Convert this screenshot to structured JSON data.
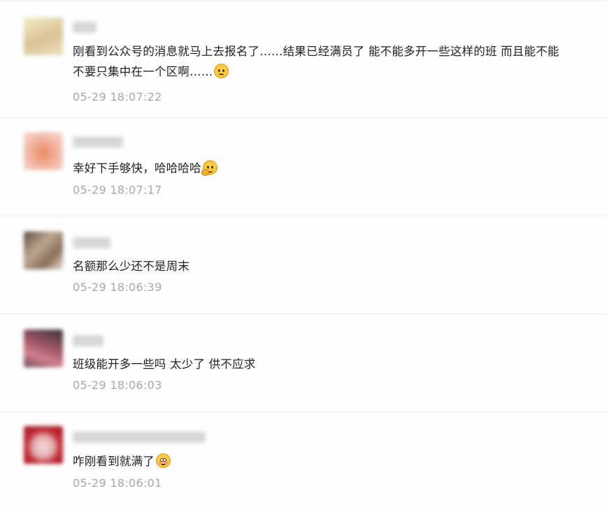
{
  "comments": [
    {
      "avatar_color": [
        "#efe3b8",
        "#d9c49a"
      ],
      "name_width": 34,
      "text": "刚看到公众号的消息就马上去报名了……结果已经满员了 能不能多开一些这样的班 而且能不能不要只集中在一个区啊……",
      "emoji": "sad-face-icon",
      "time": "05-29 18:07:22"
    },
    {
      "avatar_color": [
        "#f5c0b0",
        "#e79a80"
      ],
      "name_width": 72,
      "text": "幸好下手够快，哈哈哈哈",
      "emoji": "thinking-face-icon",
      "time": "05-29 18:07:17"
    },
    {
      "avatar_color": [
        "#b9a590",
        "#6b5a50"
      ],
      "name_width": 54,
      "text": "名额那么少还不是周末",
      "emoji": "",
      "time": "05-29 18:06:39"
    },
    {
      "avatar_color": [
        "#b56a78",
        "#4a3a3e"
      ],
      "name_width": 44,
      "text": "班级能开多一些吗 太少了 供不应求",
      "emoji": "",
      "time": "05-29 18:06:03"
    },
    {
      "avatar_color": [
        "#c8333c",
        "#f1d4d4"
      ],
      "name_width": 190,
      "text": "咋刚看到就满了",
      "emoji": "flushed-face-icon",
      "time": "05-29 18:06:01"
    }
  ]
}
